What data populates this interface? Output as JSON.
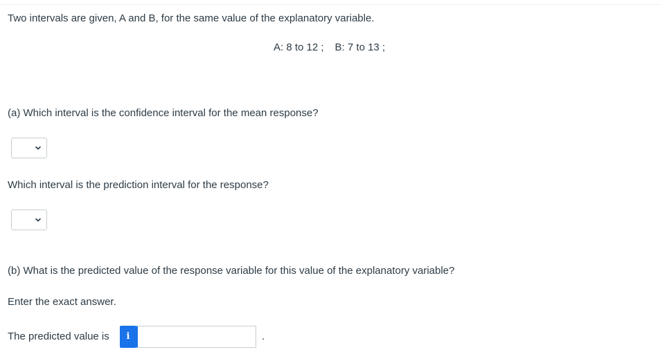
{
  "question": {
    "intro": "Two intervals are given, A and B, for the same value of the explanatory variable.",
    "interval_a": "A: 8 to 12 ;",
    "interval_b": "B: 7 to 13 ;"
  },
  "part_a": {
    "question_ci": "(a) Which interval is the confidence interval for the mean response?",
    "select_ci_value": "",
    "question_pi": "Which interval is the prediction interval for the response?",
    "select_pi_value": ""
  },
  "part_b": {
    "question": "(b) What is the predicted value of the response variable for this value of the explanatory variable?",
    "instruction": "Enter the exact answer.",
    "answer_label": "The predicted value is",
    "info_icon_glyph": "i",
    "answer_value": "",
    "period": "."
  },
  "colors": {
    "text": "#2d3b45",
    "accent": "#1a73e8",
    "border": "#c7cdd1"
  }
}
